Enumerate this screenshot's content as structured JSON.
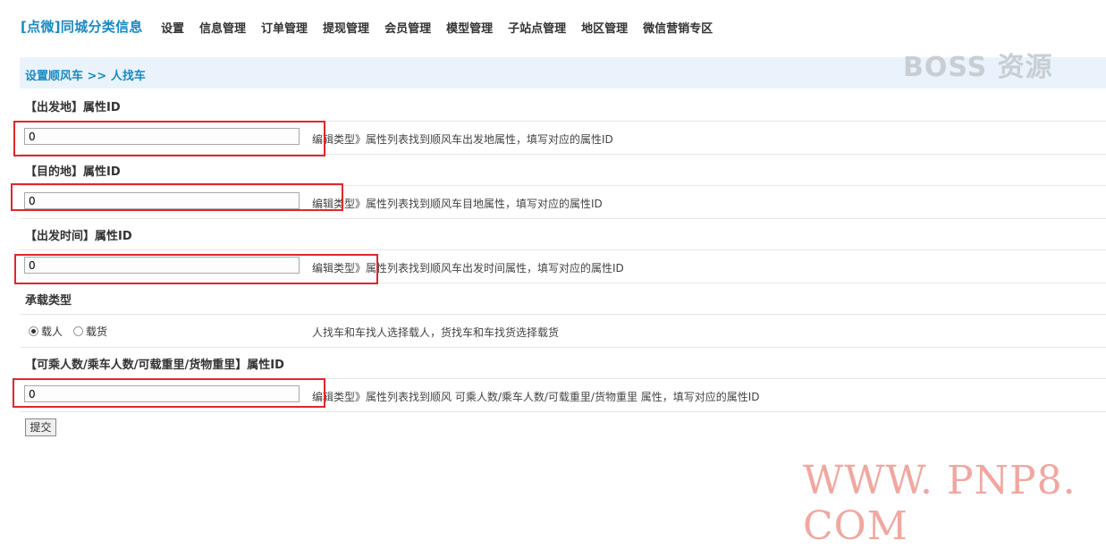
{
  "header": {
    "brand": "[点微]同城分类信息",
    "nav": [
      "设置",
      "信息管理",
      "订单管理",
      "提现管理",
      "会员管理",
      "模型管理",
      "子站点管理",
      "地区管理",
      "微信营销专区"
    ]
  },
  "breadcrumb": "设置顺风车 >> 人找车",
  "fields": [
    {
      "title": "【出发地】属性ID",
      "value": "0",
      "hint": "编辑类型》属性列表找到顺风车出发地属性，填写对应的属性ID"
    },
    {
      "title": "【目的地】属性ID",
      "value": "0",
      "hint": "编辑类型》属性列表找到顺风车目地属性，填写对应的属性ID"
    },
    {
      "title": "【出发时间】属性ID",
      "value": "0",
      "hint": "编辑类型》属性列表找到顺风车出发时间属性，填写对应的属性ID"
    }
  ],
  "carry": {
    "title": "承载类型",
    "options": [
      "载人",
      "载货"
    ],
    "selected": "载人",
    "hint": "人找车和车找人选择载人，货找车和车找货选择载货"
  },
  "capacity": {
    "title": "【可乘人数/乘车人数/可载重里/货物重里】属性ID",
    "value": "0",
    "hint": "编辑类型》属性列表找到顺风 可乘人数/乘车人数/可载重里/货物重里 属性，填写对应的属性ID"
  },
  "submit_label": "提交",
  "watermarks": {
    "top": "BOSS 资源",
    "bottom": "WWW. PNP8. COM"
  },
  "colors": {
    "accent": "#1a8ac4",
    "highlight": "#e0272b",
    "breadcrumb_bg": "#eaf3fb"
  }
}
